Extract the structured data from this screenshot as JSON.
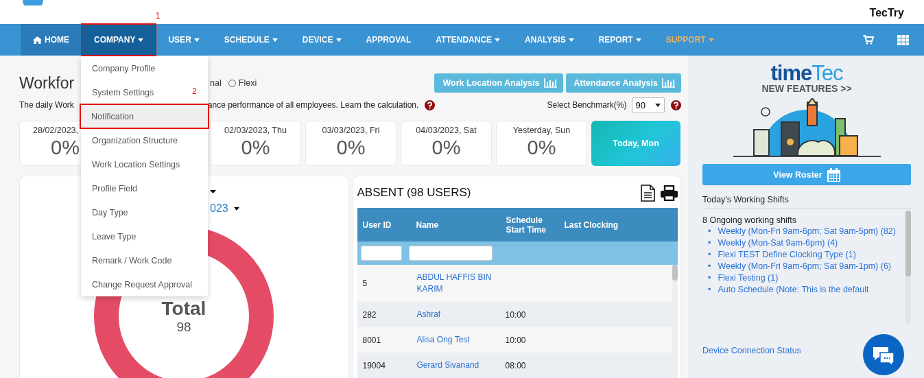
{
  "header": {
    "brand": "TecTry"
  },
  "nav": {
    "items": [
      {
        "label": "HOME",
        "kind": "home",
        "selected": true,
        "expanded": false,
        "accent": false
      },
      {
        "label": "COMPANY",
        "kind": "menu",
        "selected": false,
        "expanded": true,
        "accent": false,
        "callout": "1"
      },
      {
        "label": "USER",
        "kind": "menu",
        "selected": false,
        "expanded": false,
        "accent": false
      },
      {
        "label": "SCHEDULE",
        "kind": "menu",
        "selected": false,
        "expanded": false,
        "accent": false
      },
      {
        "label": "DEVICE",
        "kind": "menu",
        "selected": false,
        "expanded": false,
        "accent": false
      },
      {
        "label": "APPROVAL",
        "kind": "link",
        "selected": false,
        "expanded": false,
        "accent": false
      },
      {
        "label": "ATTENDANCE",
        "kind": "menu",
        "selected": false,
        "expanded": false,
        "accent": false
      },
      {
        "label": "ANALYSIS",
        "kind": "menu",
        "selected": false,
        "expanded": false,
        "accent": false
      },
      {
        "label": "REPORT",
        "kind": "menu",
        "selected": false,
        "expanded": false,
        "accent": false
      },
      {
        "label": "SUPPORT",
        "kind": "menu",
        "selected": false,
        "expanded": false,
        "accent": true
      }
    ]
  },
  "company_menu": {
    "items": [
      {
        "label": "Company Profile",
        "selected": false
      },
      {
        "label": "System Settings",
        "selected": false
      },
      {
        "label": "Notification",
        "selected": true,
        "callout": "2"
      },
      {
        "label": "Organization Structure",
        "selected": false
      },
      {
        "label": "Work Location Settings",
        "selected": false
      },
      {
        "label": "Profile Field",
        "selected": false
      },
      {
        "label": "Day Type",
        "selected": false
      },
      {
        "label": "Leave Type",
        "selected": false
      },
      {
        "label": "Remark / Work Code",
        "selected": false
      },
      {
        "label": "Change Request Approval",
        "selected": false
      }
    ]
  },
  "workforce": {
    "title_fragment": "Workfor",
    "option_fragment": "nal",
    "radio": {
      "label": "Flexi",
      "selected": false
    },
    "buttons": [
      "Work Location Analysis",
      "Attendance Analysis"
    ],
    "description_start": "The daily Work",
    "description_end": "ance performance of all employees. Learn the calculation.",
    "benchmark": {
      "label": "Select Benchmark(%)",
      "value": "90"
    },
    "day_cards": [
      {
        "date": "28/02/2023,",
        "value": "0%"
      },
      {
        "date": "02/03/2023, Thu",
        "value": "0%"
      },
      {
        "date": "03/03/2023, Fri",
        "value": "0%"
      },
      {
        "date": "04/03/2023, Sat",
        "value": "0%"
      },
      {
        "date": "Yesterday, Sun",
        "value": "0%"
      }
    ],
    "today_card": "Today, Mon"
  },
  "summary_panel": {
    "period_fragment": "023",
    "donut": {
      "label": "Total",
      "value": "98"
    }
  },
  "absent_panel": {
    "title": "ABSENT (98 USERS)",
    "columns": [
      "User ID",
      "Name",
      "Schedule Start Time",
      "Last Clocking"
    ],
    "rows": [
      {
        "user_id": "5",
        "name": "ABDUL HAFFIS BIN KARIM"
      },
      {
        "user_id": "282",
        "name": "Ashraf",
        "start_time": "10:00"
      },
      {
        "user_id": "8001",
        "name": "Alisa Ong Test",
        "start_time": "10:00"
      },
      {
        "user_id": "19004",
        "name": "Gerard Sivanand",
        "start_time": "08:00"
      }
    ]
  },
  "sidebar": {
    "logo": [
      "time",
      "Tec"
    ],
    "features_link": "NEW FEATURES >>",
    "roster_button": "View Roster",
    "shifts_title": "Today's Working Shifts",
    "shifts_summary": "8 Ongoing working shifts",
    "bullet": "•",
    "shifts": [
      "Weekly (Mon-Fri 9am-6pm; Sat 9am-5pm) (82)",
      "Weekly (Mon-Sat 9am-6pm) (4)",
      "Flexi TEST Define Clocking Type (1)",
      "Weekly (Mon-Fri 9am-6pm; Sat 9am-1pm) (6)",
      "Flexi Testing (1)",
      "Auto Schedule (Note: This is the default"
    ],
    "device_link": "Device Connection Status"
  }
}
